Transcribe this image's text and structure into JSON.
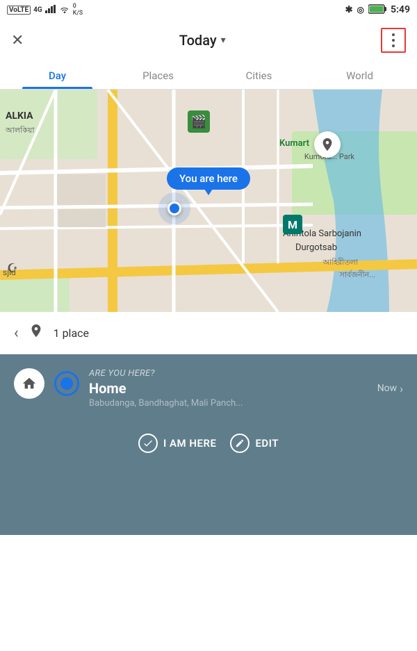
{
  "statusBar": {
    "left": "VoLTE 4G ↑↓ ☁",
    "right": "🔵 ⬡ 100 5:49"
  },
  "topBar": {
    "closeLabel": "✕",
    "title": "Today",
    "titleArrow": "▾",
    "menuDots": "⋮"
  },
  "tabs": [
    {
      "id": "day",
      "label": "Day",
      "active": true
    },
    {
      "id": "places",
      "label": "Places",
      "active": false
    },
    {
      "id": "cities",
      "label": "Cities",
      "active": false
    },
    {
      "id": "world",
      "label": "World",
      "active": false
    }
  ],
  "map": {
    "youAreHereLabel": "You are here",
    "kumarLabel": "Kumart",
    "kumorLabel": "Kumoru... Park",
    "alkiaLabel": "ALKIA",
    "alkiaBanglaLabel": "আলকিয়া",
    "ahiritola1": "Ahiritola Sarbojanin",
    "ahiritola2": "Durgotsab",
    "ahiritolaBangla": "আহিরীতলা",
    "sarbojaninBangla": "সার্বজনীন...",
    "sjidLabel": "sjid"
  },
  "placesBar": {
    "backArrow": "‹",
    "pinIcon": "📍",
    "placesCount": "1 place"
  },
  "locationCard": {
    "question": "ARE YOU HERE?",
    "name": "Home",
    "time": "Now",
    "chevron": "›",
    "address": "Babudanga, Bandhaghat, Mali Panch...",
    "actionButtons": [
      {
        "id": "i-am-here",
        "label": "I AM HERE"
      },
      {
        "id": "edit",
        "label": "EDIT"
      }
    ]
  }
}
